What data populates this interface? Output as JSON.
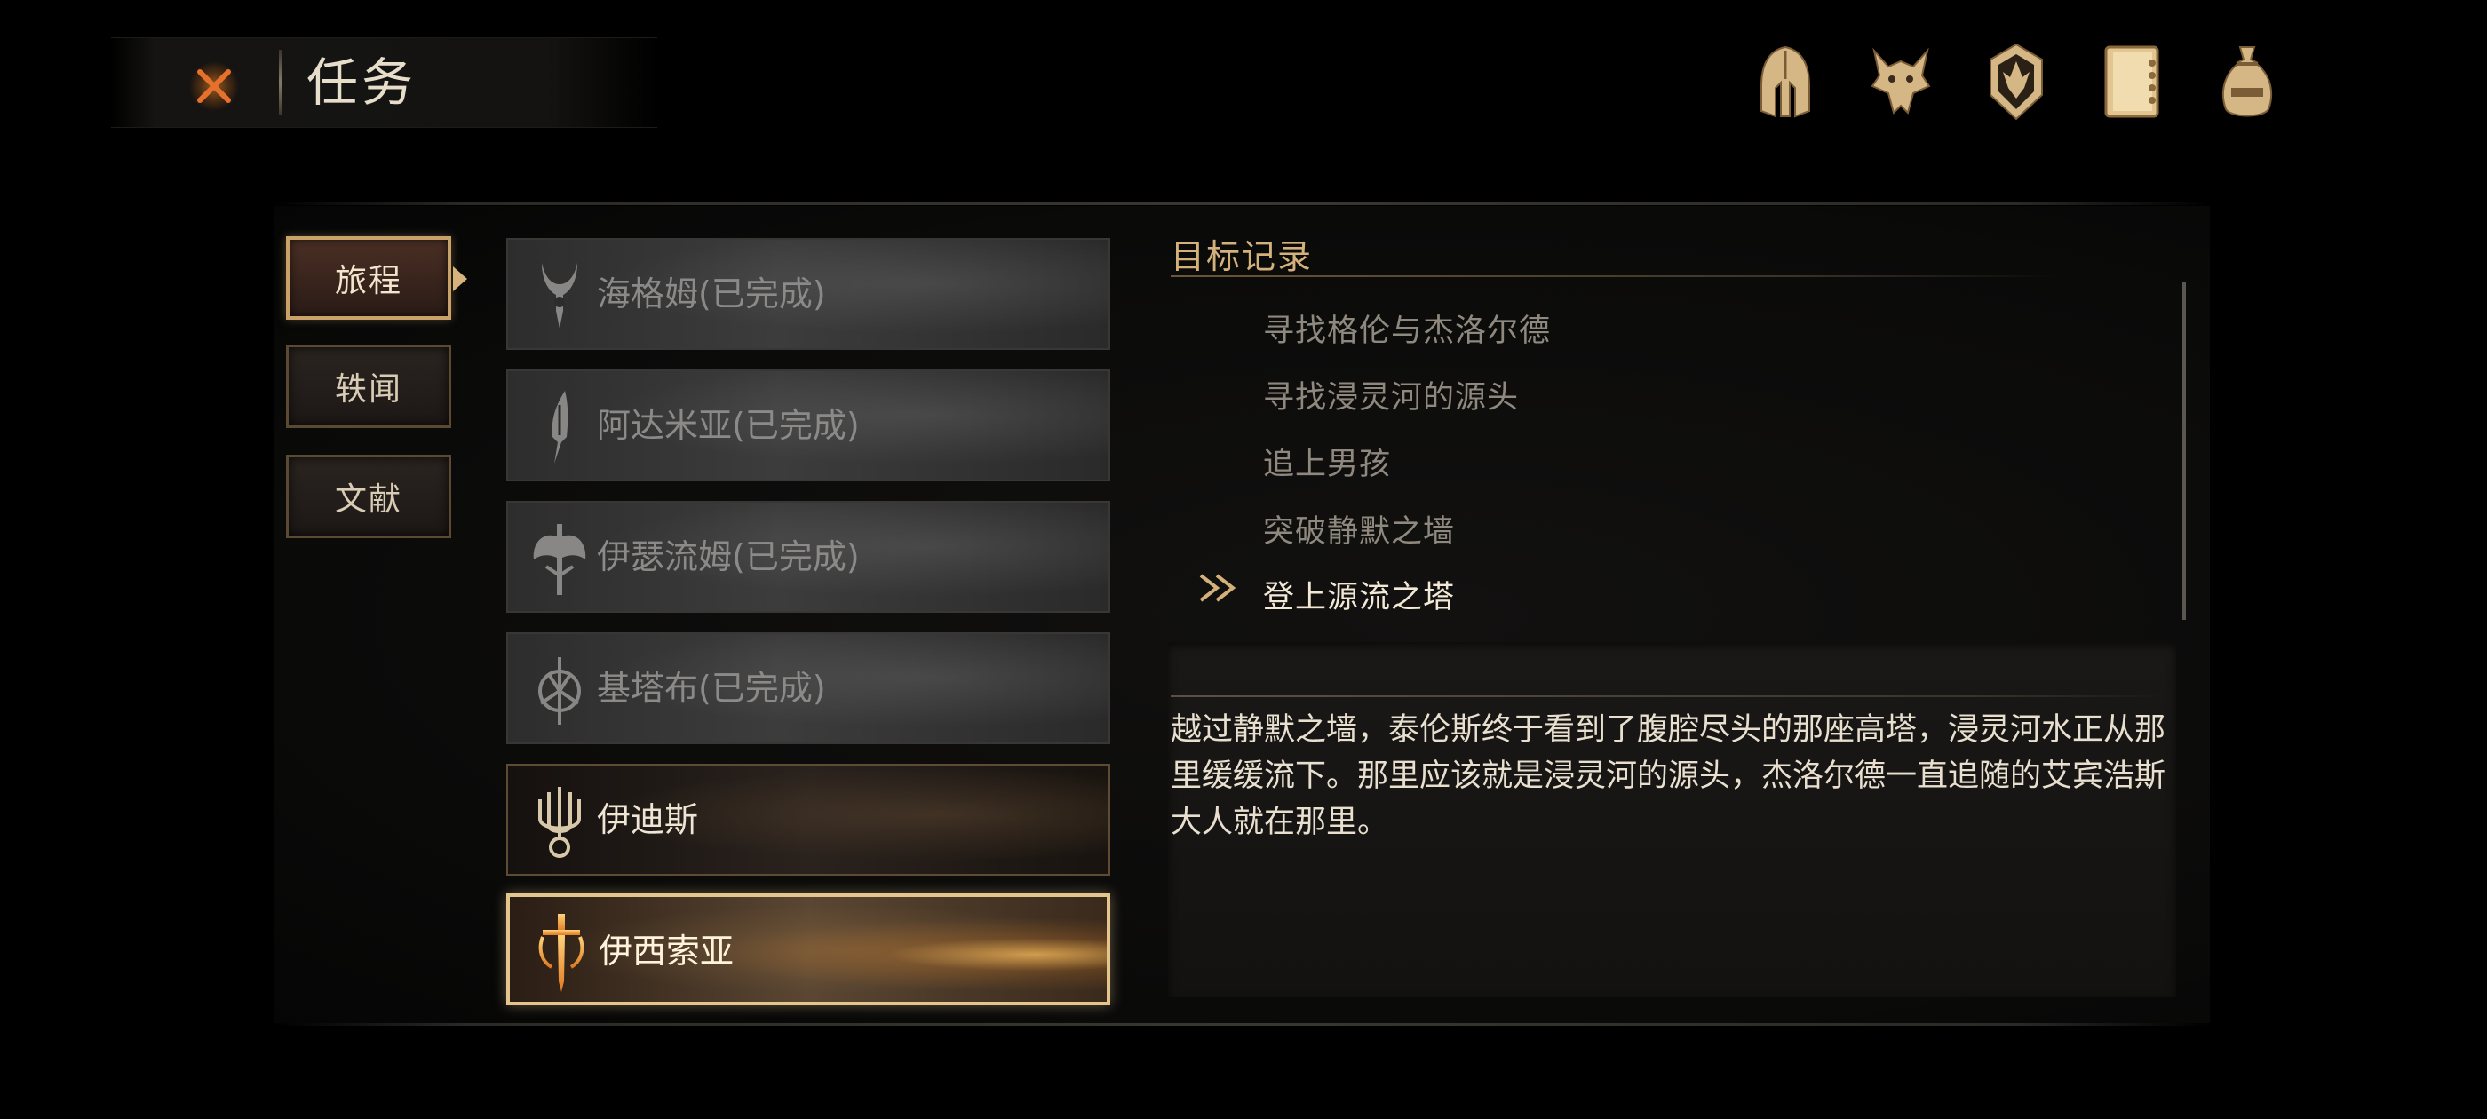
{
  "header": {
    "title": "任务",
    "close_icon": "close-x-icon",
    "top_icons": [
      "helmet-icon",
      "wolf-head-icon",
      "crest-shield-icon",
      "journal-book-icon",
      "coin-bag-icon"
    ]
  },
  "tabs": [
    {
      "label": "旅程",
      "active": true
    },
    {
      "label": "轶闻",
      "active": false
    },
    {
      "label": "文献",
      "active": false
    }
  ],
  "quests": [
    {
      "label": "海格姆(已完成)",
      "state": "done",
      "icon": "horned-sigil-icon"
    },
    {
      "label": "阿达米亚(已完成)",
      "state": "done",
      "icon": "blade-sigil-icon"
    },
    {
      "label": "伊瑟流姆(已完成)",
      "state": "done",
      "icon": "axe-sigil-icon"
    },
    {
      "label": "基塔布(已完成)",
      "state": "done",
      "icon": "trident-circle-sigil-icon"
    },
    {
      "label": "伊迪斯",
      "state": "normal",
      "icon": "candelabra-sigil-icon"
    },
    {
      "label": "伊西索亚",
      "state": "selected",
      "icon": "sword-sigil-icon"
    }
  ],
  "objectives": {
    "header": "目标记录",
    "items": [
      {
        "text": "寻找格伦与杰洛尔德",
        "current": false
      },
      {
        "text": "寻找浸灵河的源头",
        "current": false
      },
      {
        "text": "追上男孩",
        "current": false
      },
      {
        "text": "突破静默之墙",
        "current": false
      },
      {
        "text": "登上源流之塔",
        "current": true
      }
    ],
    "current_marker_icon": "double-chevron-right-icon"
  },
  "description": "越过静默之墙，泰伦斯终于看到了腹腔尽头的那座高塔，浸灵河水正从那里缓缓流下。那里应该就是浸灵河的源头，杰洛尔德一直追随的艾宾浩斯大人就在那里。",
  "colors": {
    "accent_gold": "#d4b17a",
    "close_orange": "#e0702a",
    "selected_border": "#e4c58e"
  }
}
